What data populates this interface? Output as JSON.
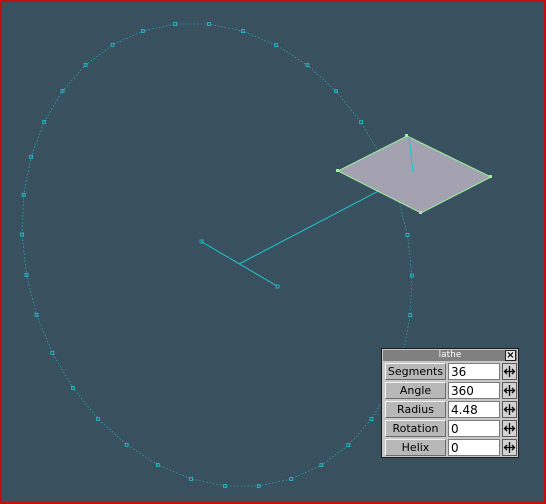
{
  "panel": {
    "title": "lathe",
    "close_label": "×",
    "fields": [
      {
        "label": "Segments",
        "value": "36"
      },
      {
        "label": "Angle",
        "value": "360"
      },
      {
        "label": "Radius",
        "value": "4.48"
      },
      {
        "label": "Rotation",
        "value": "0"
      },
      {
        "label": "Helix",
        "value": "0"
      }
    ]
  },
  "colors": {
    "background": "#39505e",
    "wire": "#1fc6d4",
    "profile_fill": "#a4a2b0",
    "profile_edge": "#9af0a0",
    "frame": "#c01010",
    "panel": "#c8c8c8"
  },
  "icons": {
    "spinner": "double-arrow-icon",
    "close": "close-icon"
  }
}
